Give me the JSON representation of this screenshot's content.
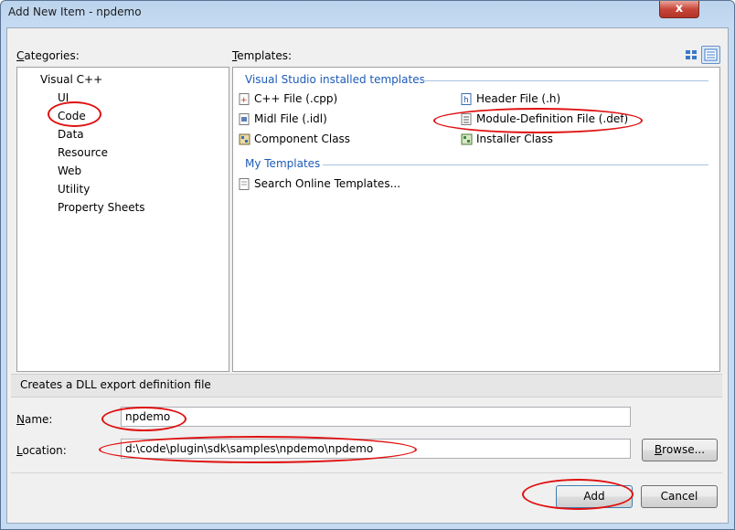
{
  "window": {
    "title": "Add New Item - npdemo",
    "close_glyph": "x"
  },
  "categories": {
    "label_u": "C",
    "label_rest": "ategories:",
    "items": [
      "Visual C++",
      "UI",
      "Code",
      "Data",
      "Resource",
      "Web",
      "Utility",
      "Property Sheets"
    ]
  },
  "templates": {
    "label_u": "T",
    "label_rest": "emplates:",
    "installed_group": "Visual Studio installed templates",
    "installed": [
      "C++ File (.cpp)",
      "Header File (.h)",
      "Midl File (.idl)",
      "Module-Definition File (.def)",
      "Component Class",
      "Installer Class"
    ],
    "my_group": "My Templates",
    "my": [
      "Search Online Templates..."
    ]
  },
  "description": "Creates a DLL export definition file",
  "name": {
    "label_u": "N",
    "label_rest": "ame:",
    "value": "npdemo"
  },
  "location": {
    "label_u": "L",
    "label_rest": "ocation:",
    "value": "d:\\code\\plugin\\sdk\\samples\\npdemo\\npdemo"
  },
  "buttons": {
    "browse_u": "B",
    "browse_rest": "rowse...",
    "add": "Add",
    "cancel": "Cancel"
  },
  "colors": {
    "annotation": "#e01010",
    "group_heading": "#1e5bb8"
  }
}
